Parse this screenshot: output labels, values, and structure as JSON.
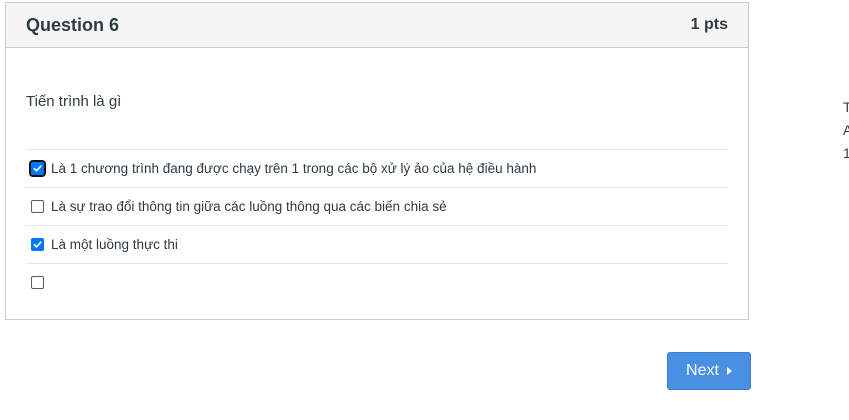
{
  "question": {
    "title": "Question 6",
    "points": "1 pts",
    "text": "Tiến trình là gì",
    "answers": [
      {
        "label": "Là 1 chương trình đang được chạy trên 1 trong các bộ xử lý ảo của hệ điều hành",
        "checked": true
      },
      {
        "label": "Là sự trao đổi thông tin giữa các luồng thông qua các biến chia sẻ",
        "checked": false
      },
      {
        "label": "Là một luồng thực thi",
        "checked": true
      },
      {
        "label": "",
        "checked": false
      }
    ]
  },
  "navigation": {
    "next_label": "Next",
    "next_icon": "caret-right-icon"
  },
  "side_panel": {
    "lines": [
      "T",
      "A",
      "1"
    ]
  },
  "colors": {
    "accent": "#4a90e2",
    "checkbox_checked": "#0075ff",
    "header_bg": "#f5f5f5",
    "border": "#c7cdd1",
    "text": "#2d3b45"
  }
}
